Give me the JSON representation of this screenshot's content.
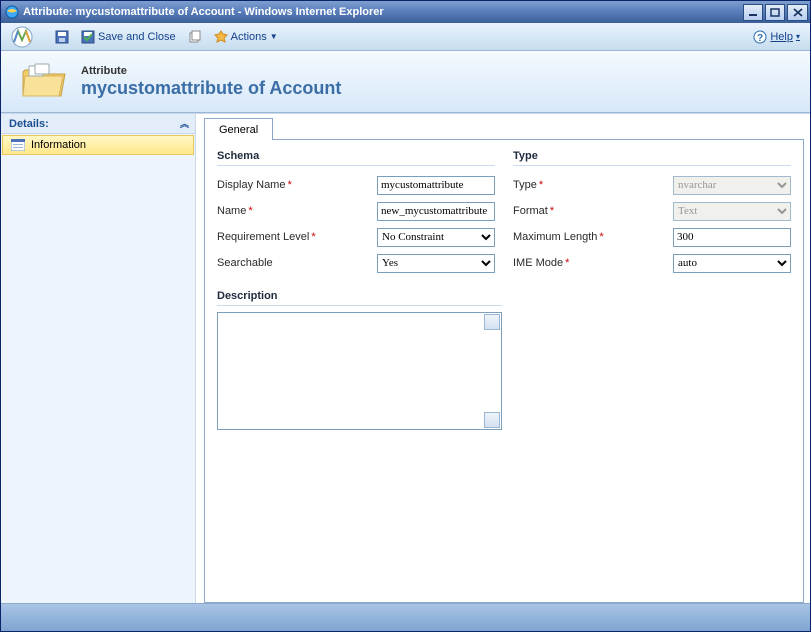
{
  "window": {
    "title": "Attribute: mycustomattribute of Account - Windows Internet Explorer"
  },
  "toolbar": {
    "save_and_close": "Save and Close",
    "actions": "Actions",
    "help": "Help"
  },
  "header": {
    "pre_title": "Attribute",
    "main_title": "mycustomattribute of Account"
  },
  "sidebar": {
    "section_title": "Details:",
    "items": [
      {
        "label": "Information"
      }
    ]
  },
  "tabs": [
    {
      "label": "General"
    }
  ],
  "form": {
    "schema_title": "Schema",
    "type_title": "Type",
    "labels": {
      "display_name": "Display Name",
      "name": "Name",
      "requirement_level": "Requirement Level",
      "searchable": "Searchable",
      "type": "Type",
      "format": "Format",
      "maximum_length": "Maximum Length",
      "ime_mode": "IME Mode",
      "description": "Description"
    },
    "values": {
      "display_name": "mycustomattribute",
      "name": "new_mycustomattribute",
      "requirement_level": "No Constraint",
      "searchable": "Yes",
      "type": "nvarchar",
      "format": "Text",
      "maximum_length": "300",
      "ime_mode": "auto",
      "description": ""
    },
    "options": {
      "requirement_level": [
        "No Constraint"
      ],
      "searchable": [
        "Yes"
      ],
      "ime_mode": [
        "auto"
      ]
    }
  }
}
